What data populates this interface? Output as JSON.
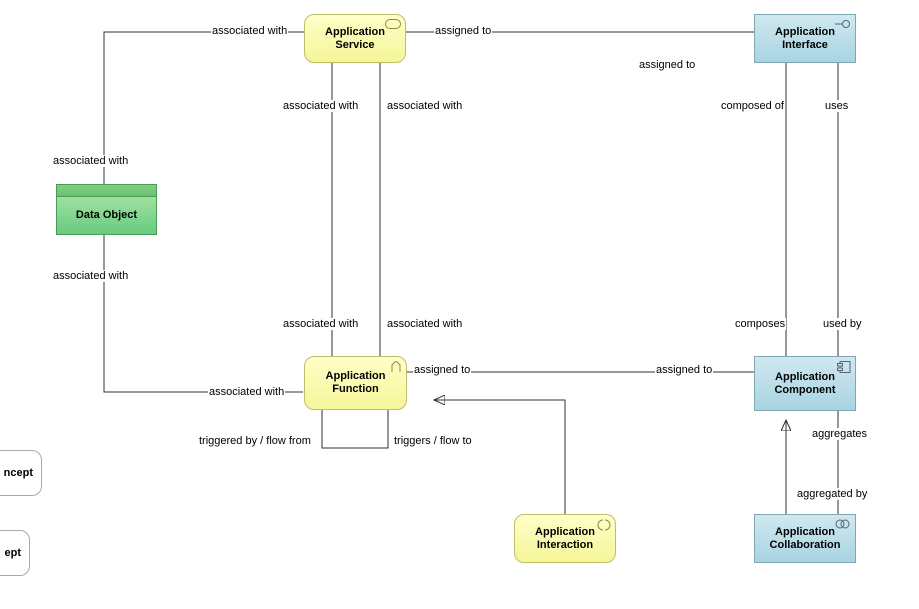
{
  "nodes": {
    "appService": {
      "label": "Application\nService"
    },
    "appInterface": {
      "label": "Application\nInterface"
    },
    "dataObject": {
      "label": "Data Object"
    },
    "appFunction": {
      "label": "Application\nFunction"
    },
    "appComponent": {
      "label": "Application\nComponent"
    },
    "appInteraction": {
      "label": "Application\nInteraction"
    },
    "appCollaboration": {
      "label": "Application\nCollaboration"
    },
    "concept1": {
      "label": "ncept"
    },
    "concept2": {
      "label": "ept"
    }
  },
  "edges": {
    "do_svc_top": "associated with",
    "do_svc_left": "associated with",
    "do_fn_left": "associated with",
    "do_fn_bottom": "associated with",
    "svc_if": "assigned to",
    "svc_if2": "assigned to",
    "svc_fn_left": "associated with",
    "svc_fn_right": "associated with",
    "fn_comp": "assigned to",
    "fn_comp2": "assigned to",
    "if_comp_left_top": "composed of",
    "if_comp_left_bot": "composes",
    "if_comp_right_top": "uses",
    "if_comp_right_bot": "used by",
    "comp_collab_top": "aggregates",
    "comp_collab_bot": "aggregated by",
    "fn_self_bot1": "triggered by / flow from",
    "fn_self_bot2": "triggers / flow to"
  },
  "colors": {
    "yellow": "#f5f59a",
    "blue": "#a8d4e2",
    "green": "#66cc80"
  }
}
